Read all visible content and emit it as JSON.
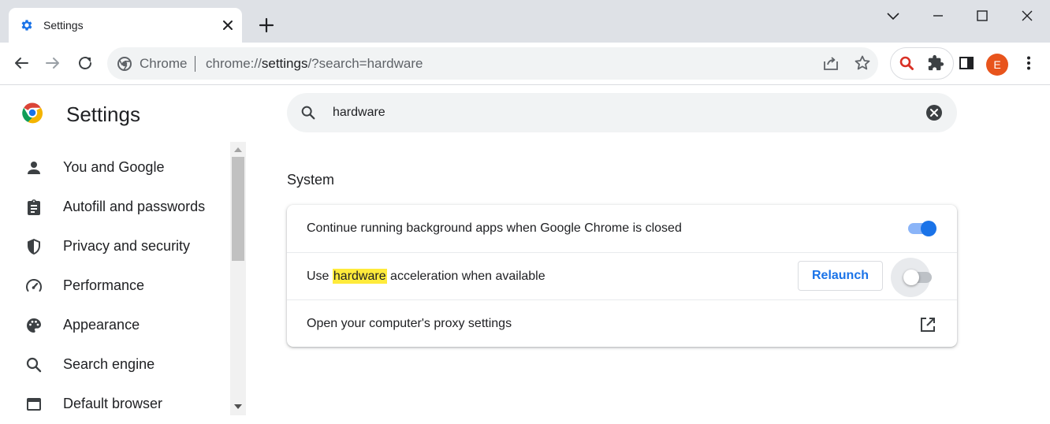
{
  "window": {
    "tab_title": "Settings",
    "minimize_icon": "minimize-icon",
    "maximize_icon": "maximize-icon",
    "close_icon": "window-close-icon"
  },
  "toolbar": {
    "omnibox_chip": "Chrome",
    "url_scheme": "chrome://",
    "url_host": "settings",
    "url_path": "/?search=hardware",
    "avatar_letter": "E"
  },
  "settings": {
    "title": "Settings",
    "search_value": "hardware",
    "sidebar": {
      "items": [
        {
          "label": "You and Google",
          "icon": "person-icon"
        },
        {
          "label": "Autofill and passwords",
          "icon": "clipboard-icon"
        },
        {
          "label": "Privacy and security",
          "icon": "shield-icon"
        },
        {
          "label": "Performance",
          "icon": "speedometer-icon"
        },
        {
          "label": "Appearance",
          "icon": "palette-icon"
        },
        {
          "label": "Search engine",
          "icon": "search-icon"
        },
        {
          "label": "Default browser",
          "icon": "browser-icon"
        }
      ]
    },
    "section_title": "System",
    "rows": {
      "background_apps": {
        "label": "Continue running background apps when Google Chrome is closed",
        "enabled": true
      },
      "hardware_accel": {
        "label_before": "Use ",
        "label_highlight": "hardware",
        "label_after": " acceleration when available",
        "button_label": "Relaunch",
        "enabled": false
      },
      "proxy": {
        "label": "Open your computer's proxy settings"
      }
    }
  },
  "colors": {
    "accent": "#1a73e8",
    "highlight": "#ffeb3b",
    "avatar": "#e8541c",
    "tabstrip": "#dee1e6"
  }
}
